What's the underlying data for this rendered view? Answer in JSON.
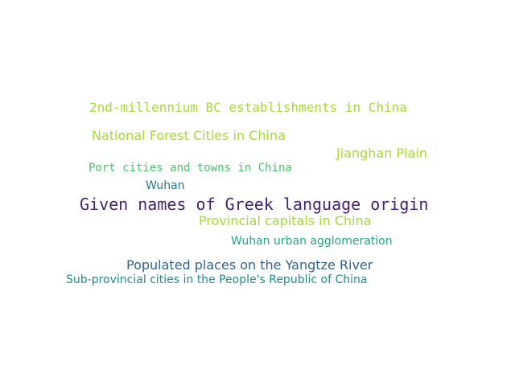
{
  "words": [
    {
      "text": "2nd-millennium BC establishments in China",
      "color": "#a5db36"
    },
    {
      "text": "National Forest Cities in China",
      "color": "#a5db36"
    },
    {
      "text": "Jianghan Plain",
      "color": "#a5db36"
    },
    {
      "text": "Port cities and towns in China",
      "color": "#4ac16d"
    },
    {
      "text": "Wuhan",
      "color": "#2a788e"
    },
    {
      "text": "Given names of Greek language origin",
      "color": "#482173"
    },
    {
      "text": "Provincial capitals in China",
      "color": "#a5db36"
    },
    {
      "text": "Wuhan urban agglomeration",
      "color": "#21a685"
    },
    {
      "text": "Populated places on the Yangtze River",
      "color": "#33638d"
    },
    {
      "text": "Sub-provincial cities in the People's Republic of China",
      "color": "#23898e"
    }
  ]
}
